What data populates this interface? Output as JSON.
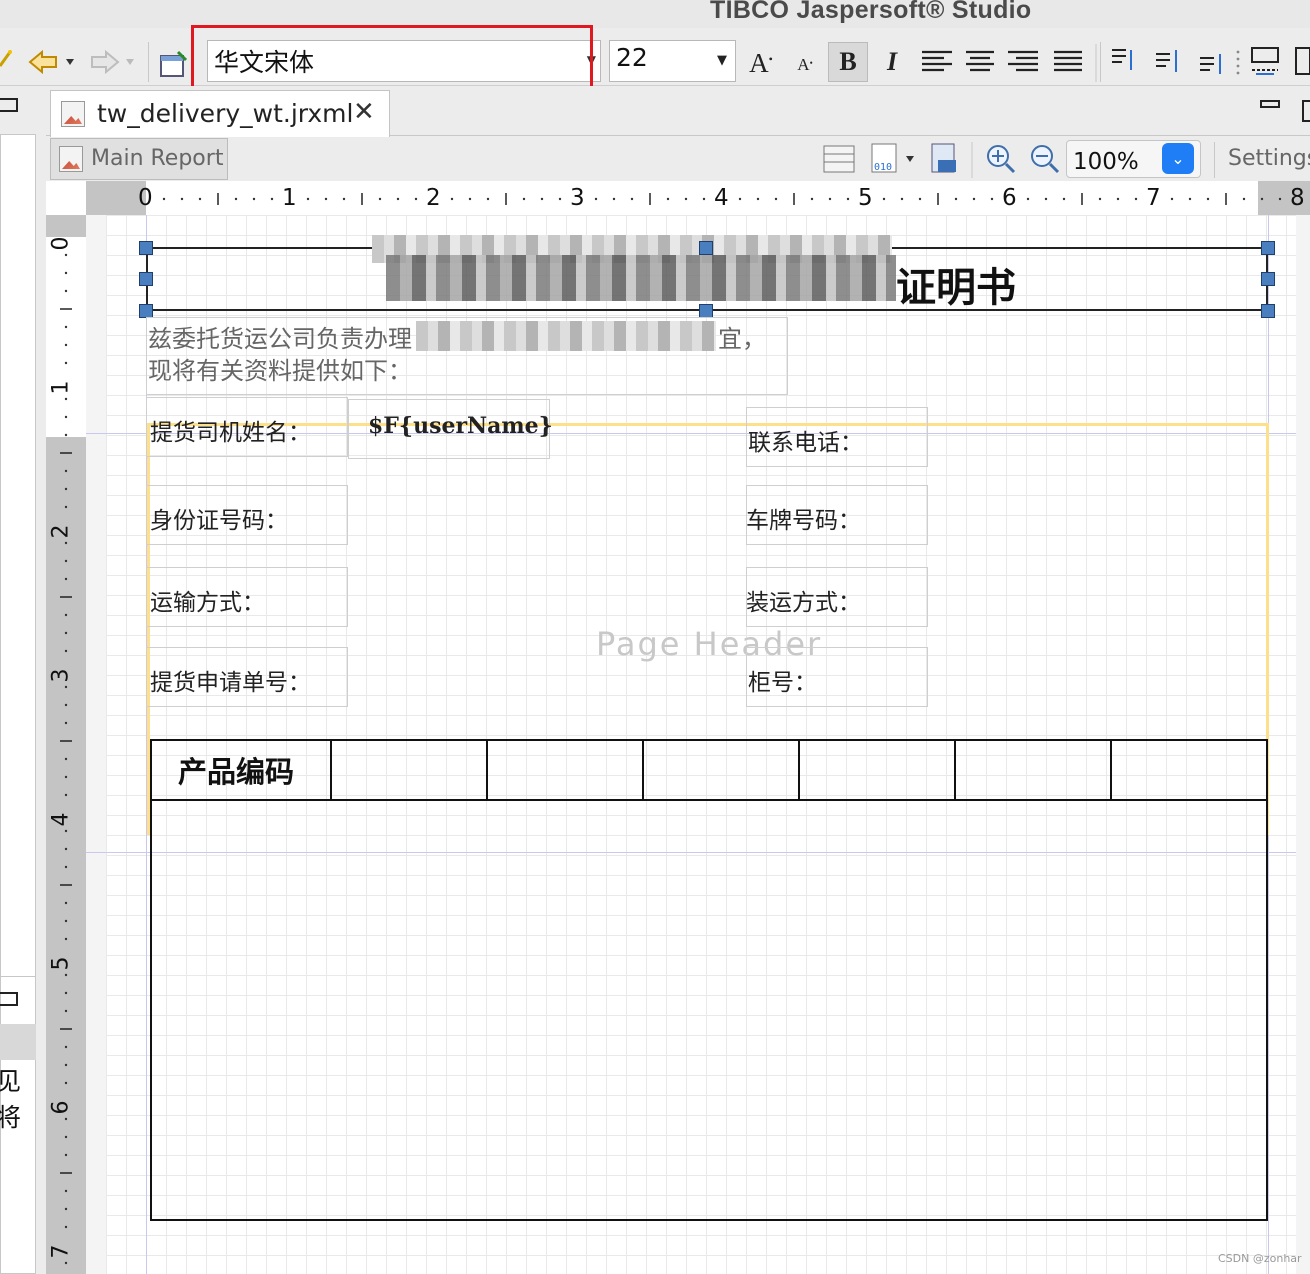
{
  "app": {
    "title": "TIBCO Jaspersoft® Studio"
  },
  "toolbar": {
    "font_name": "华文宋体",
    "font_size": "22",
    "icons": [
      "new-icon",
      "back-icon",
      "forward-icon",
      "preview-icon",
      "font-combo",
      "size-combo",
      "increase-font-icon",
      "decrease-font-icon",
      "bold-icon",
      "italic-icon",
      "align-left-icon",
      "align-center-icon",
      "align-right-icon",
      "align-justify-icon",
      "align-top-icon",
      "align-middle-icon",
      "align-bottom-icon",
      "layout-icon"
    ],
    "increase_label": "A",
    "decrease_label": "A",
    "bold_label": "B",
    "italic_label": "I"
  },
  "editor": {
    "tab_label": "tw_delivery_wt.jrxml",
    "tab_close": "✕",
    "main_report_label": "Main Report",
    "zoom": "100%",
    "settings_label": "Settings"
  },
  "ruler": {
    "horizontal": [
      "0",
      "1",
      "2",
      "3",
      "4",
      "5",
      "6",
      "7",
      "8"
    ],
    "vertical": [
      "0",
      "1",
      "2",
      "3",
      "4",
      "5",
      "6",
      "7"
    ]
  },
  "report": {
    "title_suffix": "证明书",
    "intro_line1_start": "兹委托货运公司负责办理",
    "intro_line1_end": "宜，",
    "intro_line2": "现将有关资料提供如下：",
    "user_name_field": "$F{userName}",
    "labels": {
      "driver_name": "提货司机姓名：",
      "phone": "联系电话：",
      "id_number": "身份证号码：",
      "plate": "车牌号码：",
      "transport": "运输方式：",
      "shipping": "装运方式：",
      "request_no": "提货申请单号：",
      "container": "柜号："
    },
    "band_label": "Page Header",
    "table_header": "产品编码"
  },
  "left_panel": {
    "partial_text": "见将"
  },
  "watermark": "CSDN @zonhar",
  "colors": {
    "highlight": "#e0181f",
    "handle": "#4a7fbf",
    "band": "#ffe08a",
    "zoom_button": "#1f7ef5"
  }
}
